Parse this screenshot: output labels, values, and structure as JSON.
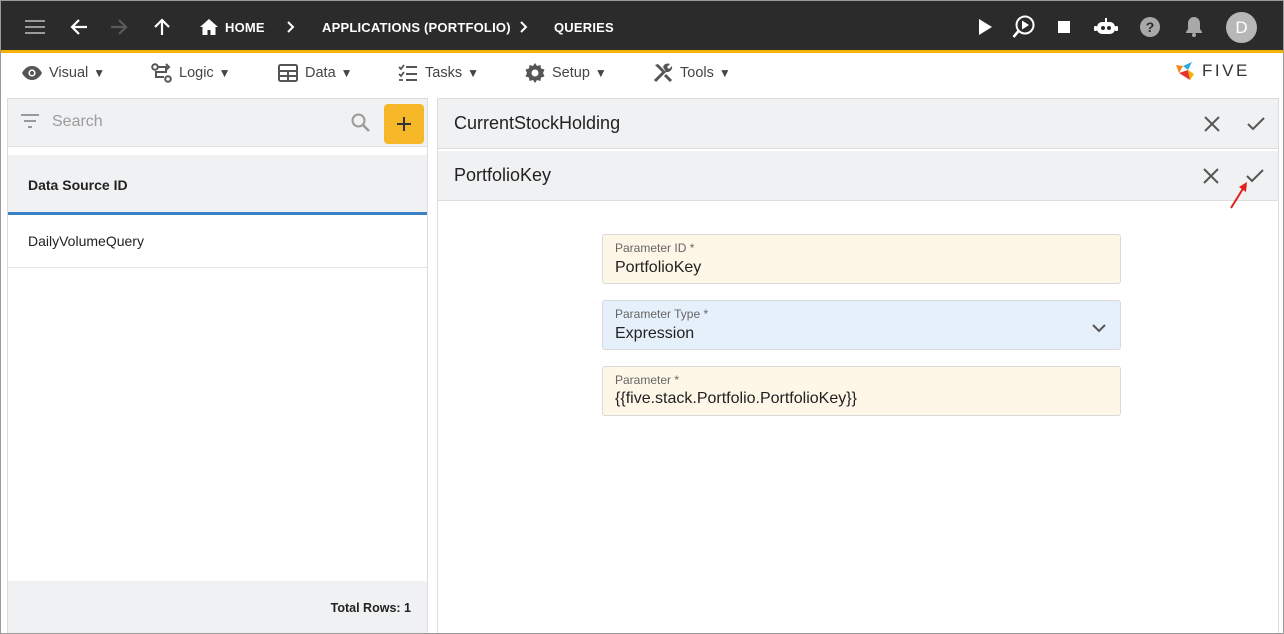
{
  "breadcrumb": {
    "home": "HOME",
    "applications": "APPLICATIONS (PORTFOLIO)",
    "queries": "QUERIES"
  },
  "user": {
    "avatar_initial": "D"
  },
  "menu": {
    "visual": "Visual",
    "logic": "Logic",
    "data": "Data",
    "tasks": "Tasks",
    "setup": "Setup",
    "tools": "Tools",
    "caret": "▼"
  },
  "brand": {
    "name": "FIVE"
  },
  "list": {
    "search_placeholder": "Search",
    "column_header": "Data Source ID",
    "rows": [
      "DailyVolumeQuery"
    ],
    "total_rows": "Total Rows: 1"
  },
  "form": {
    "record_title": "CurrentStockHolding",
    "sub_title": "PortfolioKey",
    "fields": [
      {
        "label": "Parameter ID *",
        "value": "PortfolioKey"
      },
      {
        "label": "Parameter Type *",
        "value": "Expression"
      },
      {
        "label": "Parameter *",
        "value": "{{five.stack.Portfolio.PortfolioKey}}"
      }
    ]
  },
  "colors": {
    "topbar": "#2b2b2b",
    "accent": "#f5b301",
    "add_button": "#f6b728",
    "tab_underline": "#3a82c8",
    "required_field_bg": "#fef6e6",
    "select_field_bg": "#e6f0fb",
    "annotation_arrow": "#e0201b"
  }
}
